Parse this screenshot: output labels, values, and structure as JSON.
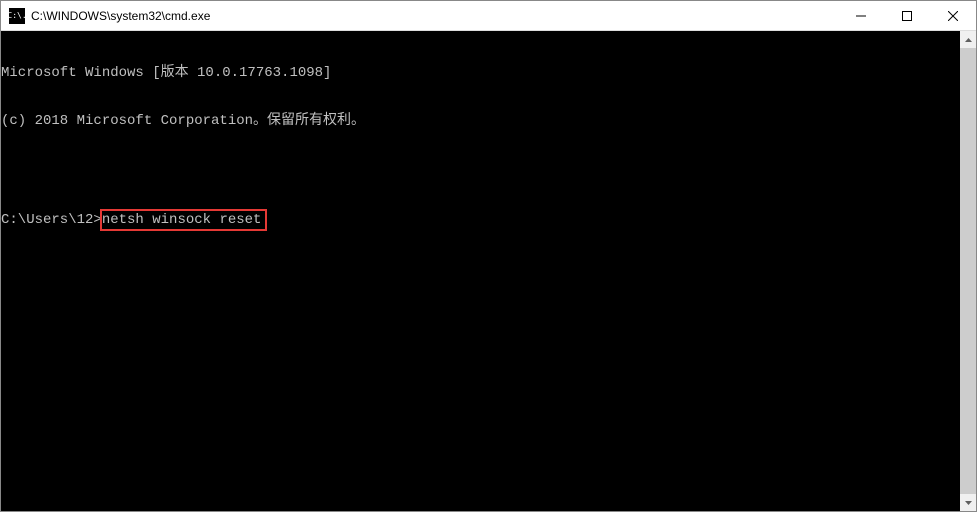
{
  "titlebar": {
    "icon_text": "C:\\.",
    "title": "C:\\WINDOWS\\system32\\cmd.exe"
  },
  "terminal": {
    "line1": "Microsoft Windows [版本 10.0.17763.1098]",
    "line2": "(c) 2018 Microsoft Corporation。保留所有权利。",
    "prompt": "C:\\Users\\12>",
    "command": "netsh winsock reset"
  }
}
